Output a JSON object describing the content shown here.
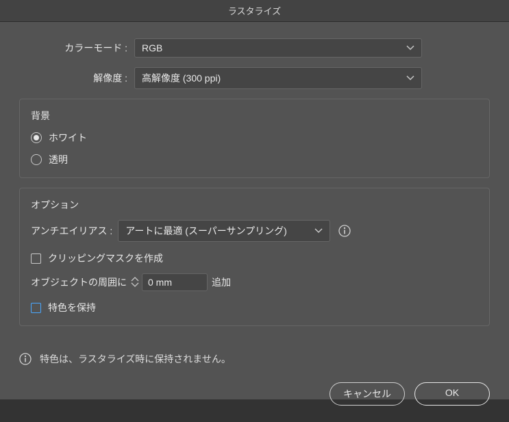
{
  "title": "ラスタライズ",
  "form": {
    "color_mode_label": "カラーモード :",
    "color_mode_value": "RGB",
    "resolution_label": "解像度 :",
    "resolution_value": "高解像度 (300 ppi)"
  },
  "background": {
    "group_title": "背景",
    "white_label": "ホワイト",
    "transparent_label": "透明",
    "selected": "white"
  },
  "options": {
    "group_title": "オプション",
    "antialias_label": "アンチエイリアス :",
    "antialias_value": "アートに最適 (スーパーサンプリング)",
    "clipping_mask_label": "クリッピングマスクを作成",
    "clipping_mask_checked": false,
    "padding_prefix": "オブジェクトの周囲に",
    "padding_value": "0 mm",
    "padding_suffix": "追加",
    "preserve_spot_label": "特色を保持",
    "preserve_spot_checked": false
  },
  "note": "特色は、ラスタライズ時に保持されません。",
  "buttons": {
    "cancel": "キャンセル",
    "ok": "OK"
  }
}
